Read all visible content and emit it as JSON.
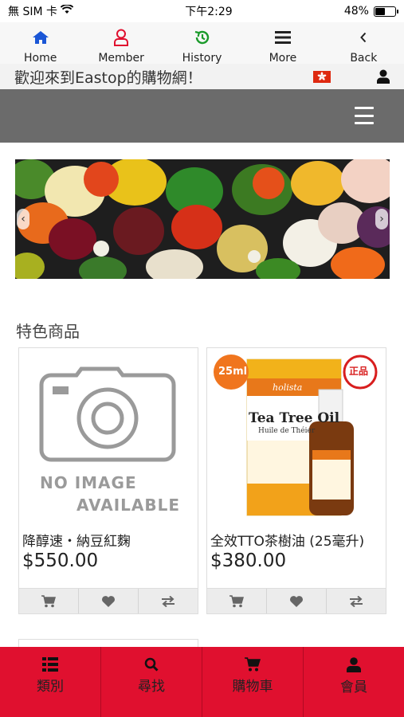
{
  "status_bar": {
    "carrier": "無 SIM 卡",
    "time": "下午2:29",
    "battery": "48%",
    "battery_level": 0.48
  },
  "top_nav": [
    {
      "label": "Home",
      "icon": "home-icon",
      "color": "#1a56d6"
    },
    {
      "label": "Member",
      "icon": "user-icon",
      "color": "#e0102f"
    },
    {
      "label": "History",
      "icon": "history-icon",
      "color": "#1a9a2a"
    },
    {
      "label": "More",
      "icon": "menu-icon",
      "color": "#222222"
    },
    {
      "label": "Back",
      "icon": "chevron-left-icon",
      "color": "#222222"
    }
  ],
  "welcome": {
    "text": "歡迎來到Eastop的購物網！"
  },
  "banner": {
    "image": "vegetables-bowls-photo"
  },
  "featured": {
    "title": "特色商品",
    "products": [
      {
        "name": "降醇速・納豆紅麴",
        "price": "$550.00",
        "image": "no-image-placeholder",
        "placeholder_line1": "NO IMAGE",
        "placeholder_line2": "AVAILABLE"
      },
      {
        "name": "全效TTO茶樹油 (25毫升)",
        "price": "$380.00",
        "image": "tea-tree-oil-product",
        "badge": "25ml",
        "brand": "holista",
        "product_title": "Tea Tree Oil",
        "product_subtitle": "Huile de Théier",
        "authentic_stamp": "正品"
      }
    ]
  },
  "bottom_nav": [
    {
      "label": "類別",
      "icon": "list-icon"
    },
    {
      "label": "尋找",
      "icon": "search-icon"
    },
    {
      "label": "購物車",
      "icon": "cart-icon"
    },
    {
      "label": "會員",
      "icon": "user-icon"
    }
  ],
  "colors": {
    "accent_red": "#e0102f",
    "header_gray": "#6b6b6b"
  }
}
